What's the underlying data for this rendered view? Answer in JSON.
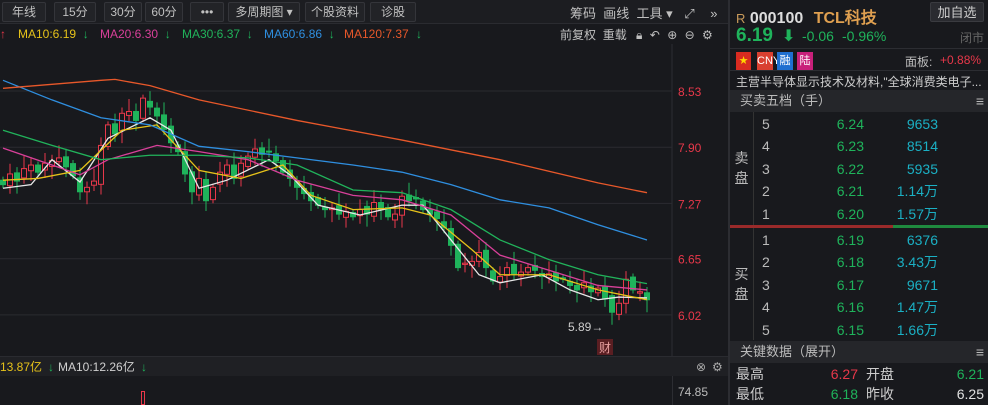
{
  "toolbar": {
    "buttons": [
      "年线",
      "15分",
      "30分",
      "60分",
      "•••",
      "多周期图 ▾",
      "个股资料",
      "诊股"
    ],
    "right_tools": [
      "筹码",
      "画线",
      "工具 ▾"
    ],
    "expand_icon": "expand-icon",
    "more_icon": "double-chevron-right-icon"
  },
  "ma_legend": [
    {
      "label": "MA10:6.19",
      "color": "#e6c21a"
    },
    {
      "label": "MA20:6.30",
      "color": "#d9409a"
    },
    {
      "label": "MA30:6.37",
      "color": "#21b35b"
    },
    {
      "label": "MA60:6.86",
      "color": "#2f8fe0"
    },
    {
      "label": "MA120:7.37",
      "color": "#e8582a"
    }
  ],
  "chart_controls": {
    "adjust": "前复权",
    "reload": "重载"
  },
  "chart_data": {
    "type": "candlestick",
    "y_ticks": [
      "8.53",
      "7.90",
      "7.27",
      "6.65",
      "6.02"
    ],
    "y_tick_values": [
      8.53,
      7.9,
      7.27,
      6.65,
      6.02
    ],
    "low_annotation": "5.89→",
    "event_marker": "财",
    "closes": [
      7.48,
      7.6,
      7.52,
      7.66,
      7.7,
      7.62,
      7.72,
      7.75,
      7.78,
      7.68,
      7.58,
      7.4,
      7.45,
      7.52,
      7.92,
      8.15,
      8.05,
      8.28,
      8.3,
      8.2,
      8.45,
      8.35,
      8.25,
      8.1,
      7.95,
      7.85,
      7.6,
      7.4,
      7.55,
      7.3,
      7.45,
      7.62,
      7.7,
      7.55,
      7.72,
      7.8,
      7.88,
      7.82,
      7.85,
      7.75,
      7.62,
      7.55,
      7.45,
      7.38,
      7.3,
      7.25,
      7.2,
      7.22,
      7.15,
      7.18,
      7.12,
      7.2,
      7.15,
      7.28,
      7.2,
      7.12,
      7.15,
      7.35,
      7.3,
      7.32,
      7.2,
      7.15,
      7.1,
      7.0,
      6.8,
      6.55,
      6.6,
      6.62,
      6.72,
      6.55,
      6.4,
      6.45,
      6.55,
      6.48,
      6.5,
      6.55,
      6.52,
      6.45,
      6.48,
      6.4,
      6.42,
      6.35,
      6.3,
      6.38,
      6.28,
      6.32,
      6.2,
      6.05,
      6.15,
      6.42,
      6.3,
      6.28,
      6.19
    ],
    "ma_lines": [
      {
        "name": "MA5",
        "color": "#e8e8e8",
        "points": [
          [
            0,
            7.44
          ],
          [
            4,
            7.48
          ],
          [
            7,
            7.76
          ],
          [
            11,
            7.51
          ],
          [
            15,
            8.0
          ],
          [
            21,
            8.23
          ],
          [
            24,
            8.09
          ],
          [
            28,
            7.44
          ],
          [
            32,
            7.53
          ],
          [
            38,
            7.76
          ],
          [
            41,
            7.59
          ],
          [
            45,
            7.25
          ],
          [
            51,
            7.14
          ],
          [
            57,
            7.25
          ],
          [
            60,
            7.25
          ],
          [
            64,
            6.86
          ],
          [
            68,
            6.47
          ],
          [
            71,
            6.38
          ],
          [
            77,
            6.47
          ],
          [
            81,
            6.3
          ],
          [
            85,
            6.19
          ],
          [
            88,
            6.22
          ],
          [
            92,
            6.21
          ]
        ]
      },
      {
        "name": "MA10",
        "color": "#e6c21a",
        "points": [
          [
            0,
            7.53
          ],
          [
            5,
            7.55
          ],
          [
            11,
            7.64
          ],
          [
            17,
            8.09
          ],
          [
            22,
            8.15
          ],
          [
            28,
            7.64
          ],
          [
            34,
            7.55
          ],
          [
            40,
            7.7
          ],
          [
            44,
            7.36
          ],
          [
            50,
            7.2
          ],
          [
            57,
            7.22
          ],
          [
            61,
            7.14
          ],
          [
            67,
            6.75
          ],
          [
            71,
            6.47
          ],
          [
            78,
            6.47
          ],
          [
            85,
            6.3
          ],
          [
            92,
            6.19
          ]
        ]
      },
      {
        "name": "MA20",
        "color": "#d9409a",
        "points": [
          [
            0,
            7.89
          ],
          [
            7,
            7.7
          ],
          [
            11,
            7.59
          ],
          [
            15,
            7.76
          ],
          [
            22,
            7.92
          ],
          [
            28,
            7.85
          ],
          [
            35,
            7.76
          ],
          [
            42,
            7.53
          ],
          [
            50,
            7.36
          ],
          [
            57,
            7.31
          ],
          [
            64,
            7.14
          ],
          [
            71,
            6.69
          ],
          [
            78,
            6.52
          ],
          [
            85,
            6.35
          ],
          [
            92,
            6.3
          ]
        ]
      },
      {
        "name": "MA30",
        "color": "#21b35b",
        "points": [
          [
            0,
            8.09
          ],
          [
            7,
            7.92
          ],
          [
            14,
            7.76
          ],
          [
            21,
            7.81
          ],
          [
            28,
            7.81
          ],
          [
            35,
            7.78
          ],
          [
            42,
            7.7
          ],
          [
            50,
            7.42
          ],
          [
            57,
            7.39
          ],
          [
            64,
            7.2
          ],
          [
            71,
            6.86
          ],
          [
            78,
            6.64
          ],
          [
            85,
            6.47
          ],
          [
            92,
            6.37
          ]
        ]
      },
      {
        "name": "MA60",
        "color": "#2f8fe0",
        "points": [
          [
            0,
            8.65
          ],
          [
            7,
            8.43
          ],
          [
            14,
            8.23
          ],
          [
            21,
            8.15
          ],
          [
            28,
            7.91
          ],
          [
            35,
            7.85
          ],
          [
            42,
            7.78
          ],
          [
            50,
            7.7
          ],
          [
            57,
            7.62
          ],
          [
            64,
            7.48
          ],
          [
            71,
            7.31
          ],
          [
            78,
            7.22
          ],
          [
            85,
            7.03
          ],
          [
            92,
            6.86
          ]
        ]
      },
      {
        "name": "MA120",
        "color": "#e8582a",
        "points": [
          [
            0,
            8.56
          ],
          [
            14,
            8.65
          ],
          [
            16,
            8.66
          ],
          [
            21,
            8.59
          ],
          [
            28,
            8.43
          ],
          [
            42,
            8.2
          ],
          [
            57,
            7.98
          ],
          [
            71,
            7.76
          ],
          [
            85,
            7.5
          ],
          [
            92,
            7.39
          ]
        ]
      }
    ]
  },
  "volume": {
    "legend": [
      {
        "label": "13.87亿",
        "color": "#e6c21a"
      },
      {
        "label": "MA10:12.26亿",
        "color": "#d0d0d0"
      }
    ],
    "y_tick": "74.85"
  },
  "stock": {
    "prefix": "R",
    "code": "000100",
    "name": "TCL科技",
    "add_watch": "加自选",
    "price": "6.19",
    "change": "-0.06",
    "change_pct": "-0.96%",
    "status": "闭市",
    "badges": [
      {
        "label": "",
        "color": "#d92b20"
      },
      {
        "label": "CNY",
        "color": "#d94030"
      },
      {
        "label": "融",
        "color": "#1f6fd0"
      },
      {
        "label": "陆",
        "color": "#c8207a"
      }
    ],
    "board_label": "面板:",
    "board_value": "+0.88%",
    "description": "主营半导体显示技术及材料,\"全球消费类电子..."
  },
  "order_book": {
    "title": "买卖五档（手）",
    "sell_label": "卖盘",
    "buy_label": "买盘",
    "sells": [
      {
        "level": "5",
        "price": "6.24",
        "volume": "9653"
      },
      {
        "level": "4",
        "price": "6.23",
        "volume": "8514"
      },
      {
        "level": "3",
        "price": "6.22",
        "volume": "5935"
      },
      {
        "level": "2",
        "price": "6.21",
        "volume": "1.14万"
      },
      {
        "level": "1",
        "price": "6.20",
        "volume": "1.57万"
      }
    ],
    "buys": [
      {
        "level": "1",
        "price": "6.19",
        "volume": "6376"
      },
      {
        "level": "2",
        "price": "6.18",
        "volume": "3.43万"
      },
      {
        "level": "3",
        "price": "6.17",
        "volume": "9671"
      },
      {
        "level": "4",
        "price": "6.16",
        "volume": "1.47万"
      },
      {
        "level": "5",
        "price": "6.15",
        "volume": "1.66万"
      }
    ],
    "buy_sell_ratio": 0.63
  },
  "key_data": {
    "title": "关键数据（展开）",
    "rows": [
      {
        "l1": "最高",
        "v1": "6.27",
        "c1": "#e8384a",
        "l2": "开盘",
        "v2": "6.21",
        "c2": "#1fb35b"
      },
      {
        "l1": "最低",
        "v1": "6.18",
        "c1": "#1fb35b",
        "l2": "昨收",
        "v2": "6.25",
        "c2": "#e0e0e0"
      }
    ]
  }
}
